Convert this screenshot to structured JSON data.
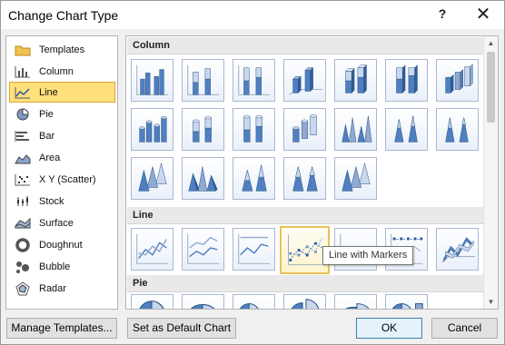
{
  "window": {
    "title": "Change Chart Type",
    "help_glyph": "?",
    "close_glyph": "✕"
  },
  "categories": [
    {
      "label": "Templates",
      "icon": "folder-icon"
    },
    {
      "label": "Column",
      "icon": "column-chart-icon"
    },
    {
      "label": "Line",
      "icon": "line-chart-icon",
      "selected": true
    },
    {
      "label": "Pie",
      "icon": "pie-chart-icon"
    },
    {
      "label": "Bar",
      "icon": "bar-chart-icon"
    },
    {
      "label": "Area",
      "icon": "area-chart-icon"
    },
    {
      "label": "X Y (Scatter)",
      "icon": "scatter-chart-icon"
    },
    {
      "label": "Stock",
      "icon": "stock-chart-icon"
    },
    {
      "label": "Surface",
      "icon": "surface-chart-icon"
    },
    {
      "label": "Doughnut",
      "icon": "doughnut-chart-icon"
    },
    {
      "label": "Bubble",
      "icon": "bubble-chart-icon"
    },
    {
      "label": "Radar",
      "icon": "radar-chart-icon"
    }
  ],
  "sections": {
    "column": {
      "label": "Column"
    },
    "line": {
      "label": "Line"
    },
    "pie": {
      "label": "Pie"
    }
  },
  "tooltip": {
    "text": "Line with Markers"
  },
  "buttons": {
    "manage_templates": "Manage Templates...",
    "set_default": "Set as Default Chart",
    "ok": "OK",
    "cancel": "Cancel"
  },
  "colors": {
    "selection": "#ffe07a",
    "selection_border": "#d9a43c",
    "chart_blue": "#4f7fc0",
    "hover": "#e9c15a"
  }
}
